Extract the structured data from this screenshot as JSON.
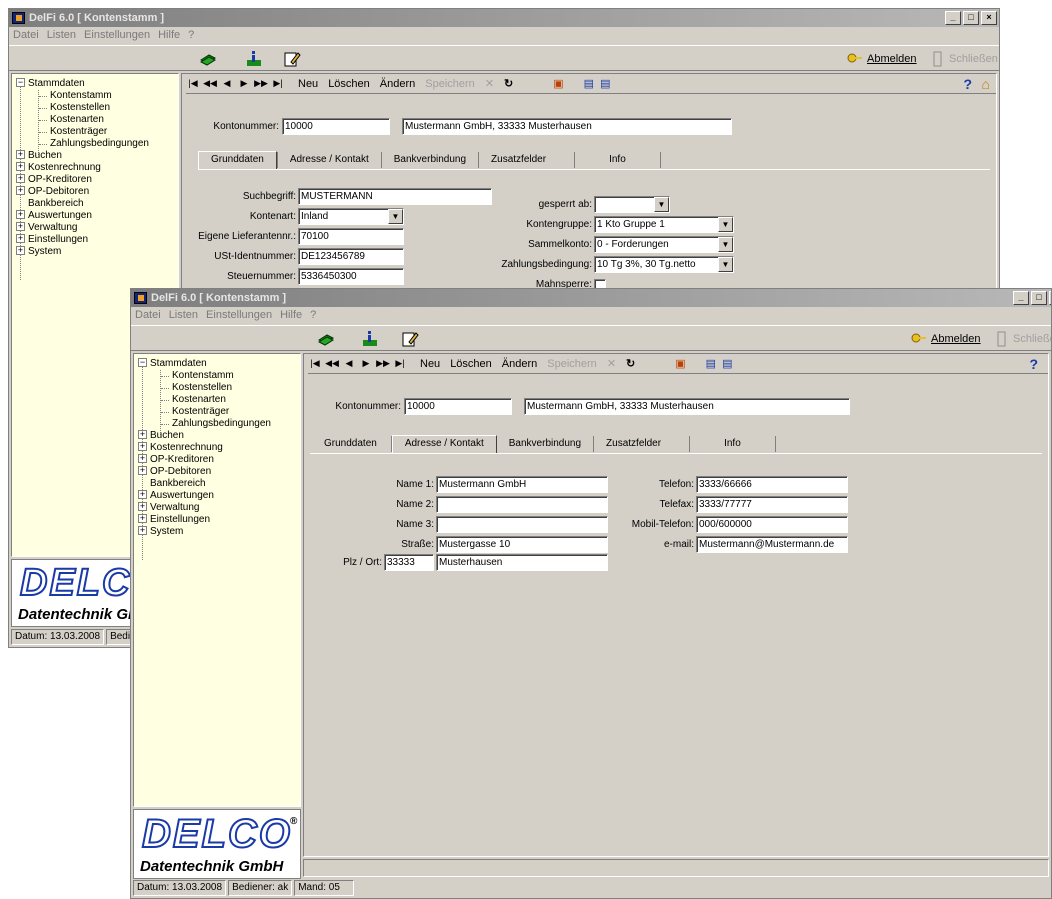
{
  "window": {
    "title": "DelFi 6.0 [ Kontenstamm ]"
  },
  "menu": [
    "Datei",
    "Listen",
    "Einstellungen",
    "Hilfe",
    "?"
  ],
  "toolbar": {
    "logout": "Abmelden",
    "close": "Schließen"
  },
  "tree": {
    "root": "Stammdaten",
    "children": [
      "Kontenstamm",
      "Kostenstellen",
      "Kostenarten",
      "Kostenträger",
      "Zahlungsbedingungen"
    ],
    "groups": [
      "Buchen",
      "Kostenrechnung",
      "OP-Kreditoren",
      "OP-Debitoren",
      "Bankbereich",
      "Auswertungen",
      "Verwaltung",
      "Einstellungen",
      "System"
    ]
  },
  "logo": {
    "brand": "DELCO",
    "sub": "Datentechnik GmbH",
    "reg": "®"
  },
  "nav": {
    "new": "Neu",
    "delete": "Löschen",
    "edit": "Ändern",
    "save": "Speichern"
  },
  "account": {
    "label": "Kontonummer:",
    "number": "10000",
    "name": "Mustermann GmbH, 33333 Musterhausen"
  },
  "tabs": [
    "Grunddaten",
    "Adresse / Kontakt",
    "Bankverbindung",
    "Zusatzfelder",
    "Info"
  ],
  "grunddaten": {
    "suchbegriff_label": "Suchbegriff:",
    "suchbegriff": "MUSTERMANN",
    "kontenart_label": "Kontenart:",
    "kontenart": "Inland",
    "lieferant_label": "Eigene Lieferantennr.:",
    "lieferant": "70100",
    "ust_label": "USt-Identnummer:",
    "ust": "DE123456789",
    "steuer_label": "Steuernummer:",
    "steuer": "5336450300",
    "gesperrt_label": "gesperrt ab:",
    "gesperrt": "",
    "gruppe_label": "Kontengruppe:",
    "gruppe": "1 Kto Gruppe 1",
    "sammel_label": "Sammelkonto:",
    "sammel": "0 - Forderungen",
    "zahl_label": "Zahlungsbedingung:",
    "zahl": "10 Tg 3%, 30 Tg.netto",
    "mahn_label": "Mahnsperre:"
  },
  "adresse": {
    "name1_label": "Name 1:",
    "name1": "Mustermann GmbH",
    "name2_label": "Name 2:",
    "name2": "",
    "name3_label": "Name 3:",
    "name3": "",
    "strasse_label": "Straße:",
    "strasse": "Mustergasse 10",
    "plz_label": "Plz / Ort:",
    "plz": "33333",
    "ort": "Musterhausen",
    "tel_label": "Telefon:",
    "tel": "3333/66666",
    "fax_label": "Telefax:",
    "fax": "3333/77777",
    "mobil_label": "Mobil-Telefon:",
    "mobil": "000/600000",
    "email_label": "e-mail:",
    "email": "Mustermann@Mustermann.de"
  },
  "status": {
    "date": "Datum: 13.03.2008",
    "user": "Bediener: ak",
    "mand": "Mand: 05",
    "user_short": "Bedier"
  },
  "colors": {
    "tree_bg": "#ffffe1",
    "face": "#d4d0c8",
    "logo_blue": "#1a3aa8"
  }
}
